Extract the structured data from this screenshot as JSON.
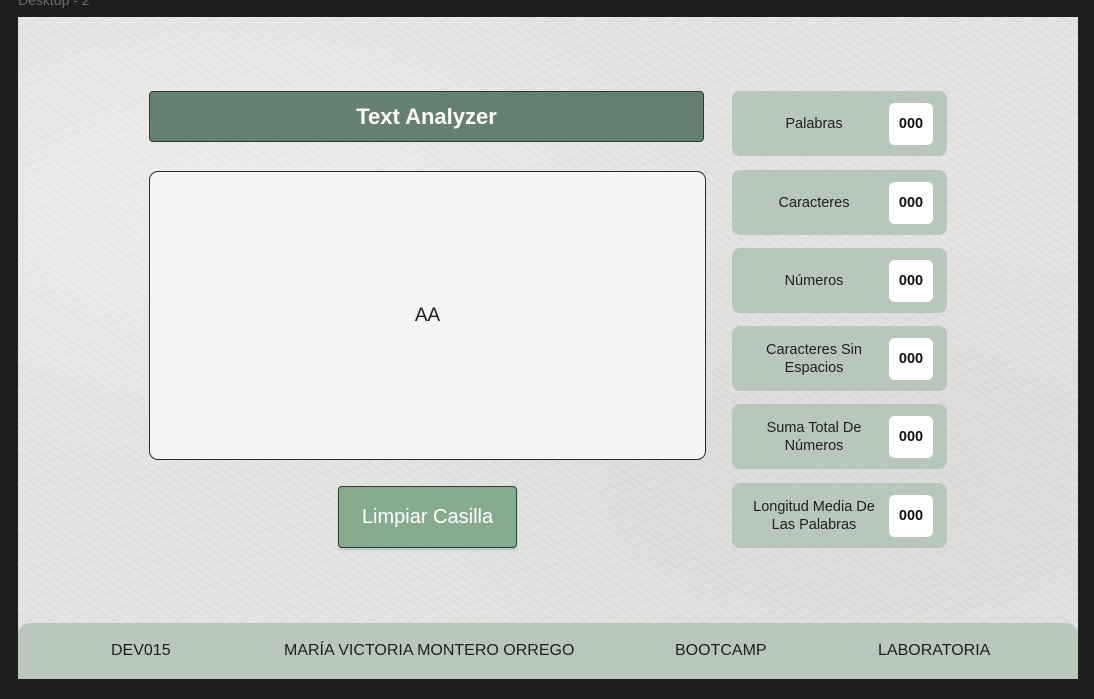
{
  "frame": {
    "label": "Desktop - 2"
  },
  "header": {
    "title": "Text Analyzer"
  },
  "editor": {
    "value": "AA"
  },
  "actions": {
    "clear_label": "Limpiar Casilla"
  },
  "stats": [
    {
      "label": "Palabras",
      "value": "000"
    },
    {
      "label": "Caracteres",
      "value": "000"
    },
    {
      "label": "Números",
      "value": "000"
    },
    {
      "label": "Caracteres Sin Espacios",
      "value": "000"
    },
    {
      "label": "Suma Total De Números",
      "value": "000"
    },
    {
      "label": "Longitud Media De Las Palabras",
      "value": "000"
    }
  ],
  "footer": {
    "code": "DEV015",
    "author": "MARÍA VICTORIA MONTERO ORREGO",
    "program": "BOOTCAMP",
    "org": "LABORATORIA"
  },
  "colors": {
    "title_bg": "#658070",
    "button_bg": "#86ab8f",
    "card_bg": "#b7c8ba",
    "canvas_bg": "#e4e4e3"
  }
}
